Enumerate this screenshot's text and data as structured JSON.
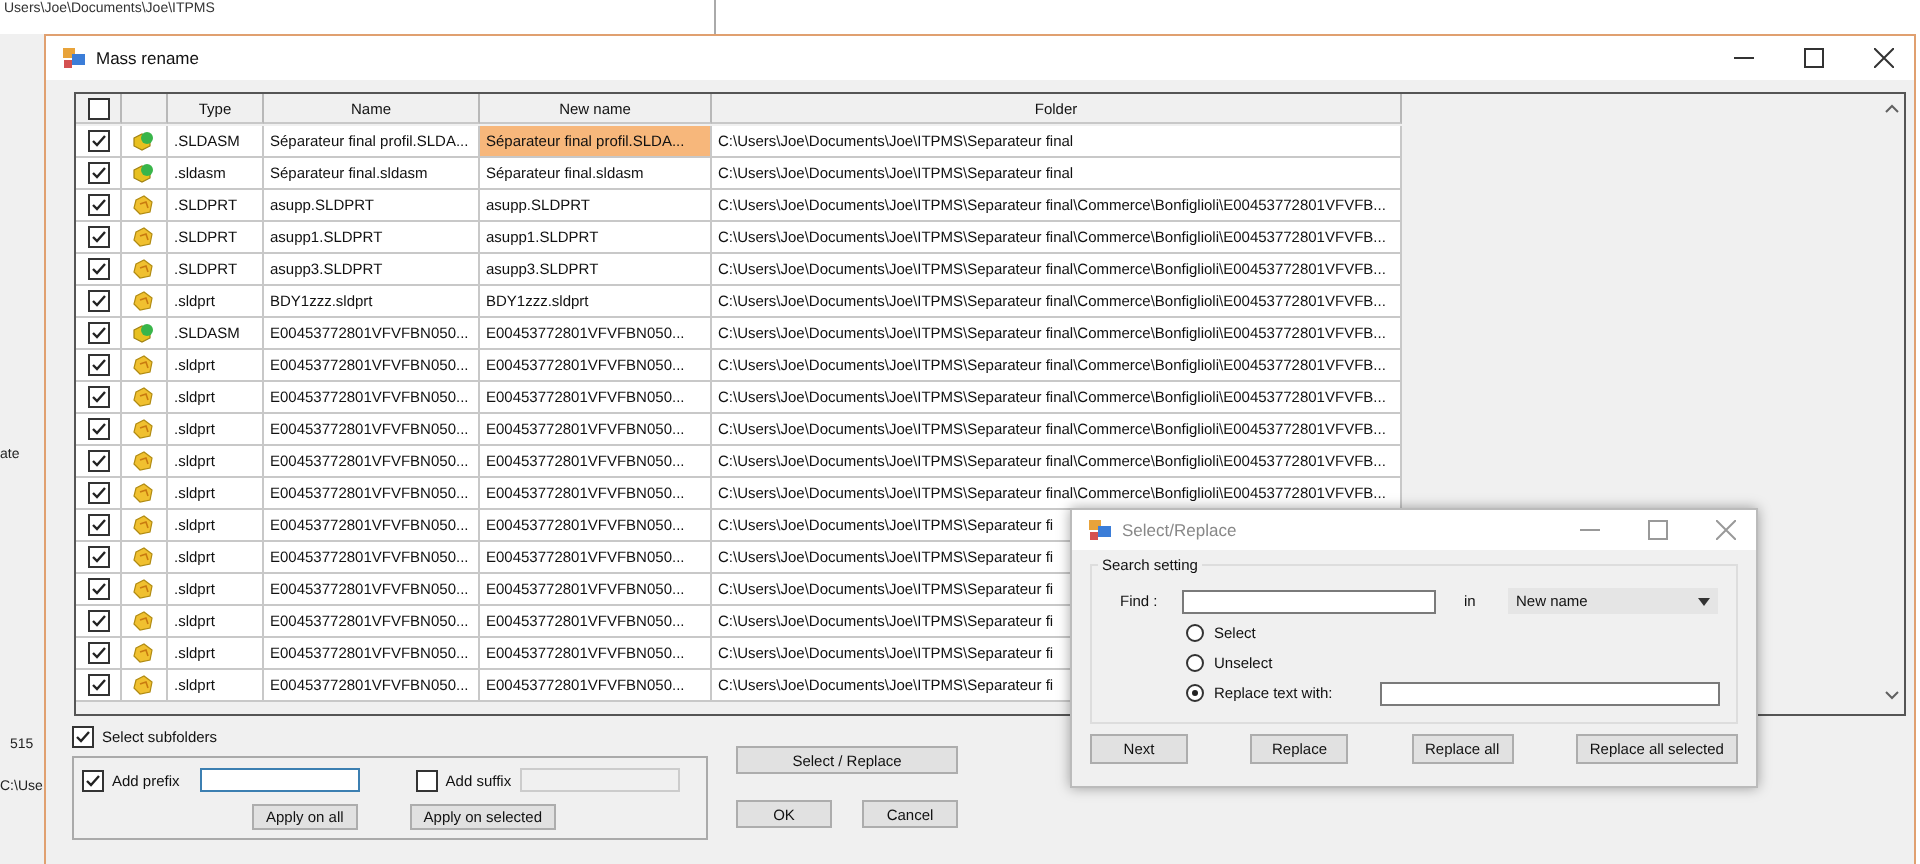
{
  "background_window": {
    "path_text": "Users\\Joe\\Documents\\Joe\\ITPMS",
    "side_texts": [
      "ate",
      "515",
      "C:\\Use"
    ]
  },
  "window": {
    "title": "Mass rename"
  },
  "table": {
    "columns": [
      "Type",
      "Name",
      "New name",
      "Folder"
    ],
    "select_all_checked": false,
    "rows": [
      {
        "checked": true,
        "kind": "assembly",
        "type": ".SLDASM",
        "name": "Séparateur final profil.SLDA...",
        "new_name": "Séparateur final profil.SLDA...",
        "folder": "C:\\Users\\Joe\\Documents\\Joe\\ITPMS\\Separateur final",
        "selected": true
      },
      {
        "checked": true,
        "kind": "assembly",
        "type": ".sldasm",
        "name": "Séparateur final.sldasm",
        "new_name": "Séparateur final.sldasm",
        "folder": "C:\\Users\\Joe\\Documents\\Joe\\ITPMS\\Separateur final",
        "selected": false
      },
      {
        "checked": true,
        "kind": "part",
        "type": ".SLDPRT",
        "name": "asupp.SLDPRT",
        "new_name": "asupp.SLDPRT",
        "folder": "C:\\Users\\Joe\\Documents\\Joe\\ITPMS\\Separateur final\\Commerce\\Bonfiglioli\\E00453772801VFVFB...",
        "selected": false
      },
      {
        "checked": true,
        "kind": "part",
        "type": ".SLDPRT",
        "name": "asupp1.SLDPRT",
        "new_name": "asupp1.SLDPRT",
        "folder": "C:\\Users\\Joe\\Documents\\Joe\\ITPMS\\Separateur final\\Commerce\\Bonfiglioli\\E00453772801VFVFB...",
        "selected": false
      },
      {
        "checked": true,
        "kind": "part",
        "type": ".SLDPRT",
        "name": "asupp3.SLDPRT",
        "new_name": "asupp3.SLDPRT",
        "folder": "C:\\Users\\Joe\\Documents\\Joe\\ITPMS\\Separateur final\\Commerce\\Bonfiglioli\\E00453772801VFVFB...",
        "selected": false
      },
      {
        "checked": true,
        "kind": "part",
        "type": ".sldprt",
        "name": "BDY1zzz.sldprt",
        "new_name": "BDY1zzz.sldprt",
        "folder": "C:\\Users\\Joe\\Documents\\Joe\\ITPMS\\Separateur final\\Commerce\\Bonfiglioli\\E00453772801VFVFB...",
        "selected": false
      },
      {
        "checked": true,
        "kind": "assembly",
        "type": ".SLDASM",
        "name": "E00453772801VFVFBN050...",
        "new_name": "E00453772801VFVFBN050...",
        "folder": "C:\\Users\\Joe\\Documents\\Joe\\ITPMS\\Separateur final\\Commerce\\Bonfiglioli\\E00453772801VFVFB...",
        "selected": false
      },
      {
        "checked": true,
        "kind": "part",
        "type": ".sldprt",
        "name": "E00453772801VFVFBN050...",
        "new_name": "E00453772801VFVFBN050...",
        "folder": "C:\\Users\\Joe\\Documents\\Joe\\ITPMS\\Separateur final\\Commerce\\Bonfiglioli\\E00453772801VFVFB...",
        "selected": false
      },
      {
        "checked": true,
        "kind": "part",
        "type": ".sldprt",
        "name": "E00453772801VFVFBN050...",
        "new_name": "E00453772801VFVFBN050...",
        "folder": "C:\\Users\\Joe\\Documents\\Joe\\ITPMS\\Separateur final\\Commerce\\Bonfiglioli\\E00453772801VFVFB...",
        "selected": false
      },
      {
        "checked": true,
        "kind": "part",
        "type": ".sldprt",
        "name": "E00453772801VFVFBN050...",
        "new_name": "E00453772801VFVFBN050...",
        "folder": "C:\\Users\\Joe\\Documents\\Joe\\ITPMS\\Separateur final\\Commerce\\Bonfiglioli\\E00453772801VFVFB...",
        "selected": false
      },
      {
        "checked": true,
        "kind": "part",
        "type": ".sldprt",
        "name": "E00453772801VFVFBN050...",
        "new_name": "E00453772801VFVFBN050...",
        "folder": "C:\\Users\\Joe\\Documents\\Joe\\ITPMS\\Separateur final\\Commerce\\Bonfiglioli\\E00453772801VFVFB...",
        "selected": false
      },
      {
        "checked": true,
        "kind": "part",
        "type": ".sldprt",
        "name": "E00453772801VFVFBN050...",
        "new_name": "E00453772801VFVFBN050...",
        "folder": "C:\\Users\\Joe\\Documents\\Joe\\ITPMS\\Separateur final\\Commerce\\Bonfiglioli\\E00453772801VFVFB...",
        "selected": false
      },
      {
        "checked": true,
        "kind": "part",
        "type": ".sldprt",
        "name": "E00453772801VFVFBN050...",
        "new_name": "E00453772801VFVFBN050...",
        "folder": "C:\\Users\\Joe\\Documents\\Joe\\ITPMS\\Separateur fi",
        "selected": false
      },
      {
        "checked": true,
        "kind": "part",
        "type": ".sldprt",
        "name": "E00453772801VFVFBN050...",
        "new_name": "E00453772801VFVFBN050...",
        "folder": "C:\\Users\\Joe\\Documents\\Joe\\ITPMS\\Separateur fi",
        "selected": false
      },
      {
        "checked": true,
        "kind": "part",
        "type": ".sldprt",
        "name": "E00453772801VFVFBN050...",
        "new_name": "E00453772801VFVFBN050...",
        "folder": "C:\\Users\\Joe\\Documents\\Joe\\ITPMS\\Separateur fi",
        "selected": false
      },
      {
        "checked": true,
        "kind": "part",
        "type": ".sldprt",
        "name": "E00453772801VFVFBN050...",
        "new_name": "E00453772801VFVFBN050...",
        "folder": "C:\\Users\\Joe\\Documents\\Joe\\ITPMS\\Separateur fi",
        "selected": false
      },
      {
        "checked": true,
        "kind": "part",
        "type": ".sldprt",
        "name": "E00453772801VFVFBN050...",
        "new_name": "E00453772801VFVFBN050...",
        "folder": "C:\\Users\\Joe\\Documents\\Joe\\ITPMS\\Separateur fi",
        "selected": false
      },
      {
        "checked": true,
        "kind": "part",
        "type": ".sldprt",
        "name": "E00453772801VFVFBN050...",
        "new_name": "E00453772801VFVFBN050...",
        "folder": "C:\\Users\\Joe\\Documents\\Joe\\ITPMS\\Separateur fi",
        "selected": false
      }
    ]
  },
  "options": {
    "select_subfolders": {
      "label": "Select subfolders",
      "checked": true
    },
    "prefix": {
      "label": "Add prefix",
      "checked": true
    },
    "suffix": {
      "label": "Add suffix",
      "checked": false
    },
    "apply_buttons": [
      "Apply on all",
      "Apply on selected"
    ]
  },
  "side_buttons": {
    "select_replace": "Select / Replace",
    "ok": "OK",
    "cancel": "Cancel"
  },
  "dialog": {
    "title": "Select/Replace",
    "group": "Search setting",
    "find_label": "Find :",
    "in_label": "in",
    "field": "New name",
    "modes": [
      {
        "label": "Select",
        "selected": false
      },
      {
        "label": "Unselect",
        "selected": false
      },
      {
        "label": "Replace text with:",
        "selected": true
      }
    ],
    "buttons": [
      "Next",
      "Replace",
      "Replace all",
      "Replace all selected"
    ]
  }
}
